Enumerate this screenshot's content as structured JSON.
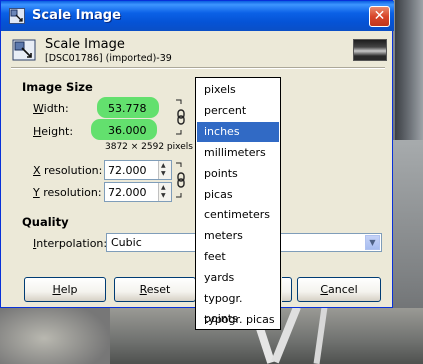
{
  "window": {
    "title": "Scale Image",
    "close_glyph": "✕"
  },
  "header": {
    "title": "Scale Image",
    "subtitle": "[DSC01786] (imported)-39"
  },
  "image_size": {
    "section_title": "Image Size",
    "width_label_key": "W",
    "width_label_rest": "idth:",
    "width_value": "53.778",
    "height_label_key": "H",
    "height_label_rest": "eight:",
    "height_value": "36.000",
    "pixels_info": "3872 × 2592 pixels",
    "xres_label_key": "X",
    "xres_label_rest": " resolution:",
    "xres_value": "72.000",
    "yres_label_key": "Y",
    "yres_label_rest": " resolution:",
    "yres_value": "72.000"
  },
  "quality": {
    "section_title": "Quality",
    "interp_label_key": "I",
    "interp_label_rest": "nterpolation:",
    "interp_value": "Cubic"
  },
  "buttons": {
    "help_key": "H",
    "help_rest": "elp",
    "reset_key": "R",
    "reset_rest": "eset",
    "cancel_key": "C",
    "cancel_rest": "ancel"
  },
  "unit_dropdown": {
    "items": [
      "pixels",
      "percent",
      "inches",
      "millimeters",
      "points",
      "picas",
      "centimeters",
      "meters",
      "feet",
      "yards",
      "typogr. points",
      "typogr. picas"
    ],
    "selected": "inches"
  },
  "colors": {
    "title_bar": "#0b61e6",
    "dialog_bg": "#ece9d8",
    "highlight_green": "#63e06e",
    "selection_blue": "#316ac5"
  },
  "icons": [
    "scale-image-icon",
    "close-icon",
    "chain-link-icon",
    "spin-arrows-icon",
    "dropdown-arrow-icon",
    "image-thumbnail"
  ]
}
